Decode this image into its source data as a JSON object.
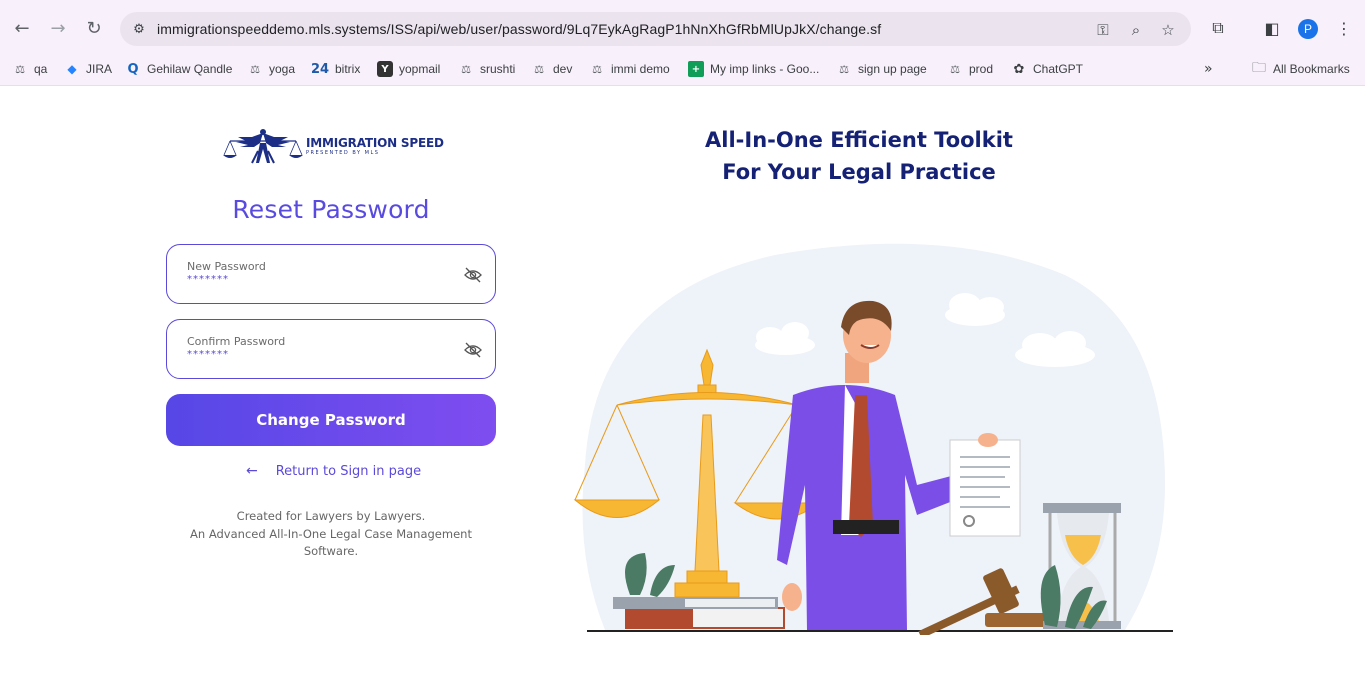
{
  "browser": {
    "url": "immigrationspeeddemo.mls.systems/ISS/api/web/user/password/9Lq7EykAgRagP1hNnXhGfRbMlUpJkX/change.sf",
    "profile_initial": "P",
    "bookmarks": [
      {
        "label": "qa",
        "icon": "scale-icon"
      },
      {
        "label": "JIRA",
        "icon": "jira-icon"
      },
      {
        "label": "Gehilaw Qandle",
        "icon": "qandle-icon"
      },
      {
        "label": "yoga",
        "icon": "scale-icon"
      },
      {
        "label": "bitrix",
        "icon": "bitrix24-icon"
      },
      {
        "label": "yopmail",
        "icon": "yopmail-icon"
      },
      {
        "label": "srushti",
        "icon": "scale-icon"
      },
      {
        "label": "dev",
        "icon": "scale-icon"
      },
      {
        "label": "immi demo",
        "icon": "scale-icon"
      },
      {
        "label": "My imp links - Goo...",
        "icon": "sheets-icon"
      },
      {
        "label": "sign up page",
        "icon": "scale-icon"
      },
      {
        "label": "prod",
        "icon": "scale-icon"
      },
      {
        "label": "ChatGPT",
        "icon": "chatgpt-icon"
      }
    ],
    "all_bookmarks_label": "All Bookmarks"
  },
  "logo": {
    "title": "IMMIGRATION SPEED",
    "subtitle": "PRESENTED BY MLS"
  },
  "form": {
    "title": "Reset Password",
    "new_password": {
      "label": "New Password",
      "value": "*******"
    },
    "confirm_password": {
      "label": "Confirm Password",
      "value": "*******"
    },
    "submit_label": "Change Password",
    "back_link": "Return to Sign in page"
  },
  "footer": {
    "line1": "Created for Lawyers by Lawyers.",
    "line2": "An Advanced All-In-One Legal Case Management Software."
  },
  "hero": {
    "line1": "All-In-One Efficient Toolkit",
    "line2": "For Your Legal Practice"
  },
  "colors": {
    "accent": "#5b4ad9",
    "heading_navy": "#142174",
    "button_gradient_start": "#5647e6",
    "button_gradient_end": "#7f4df0"
  }
}
